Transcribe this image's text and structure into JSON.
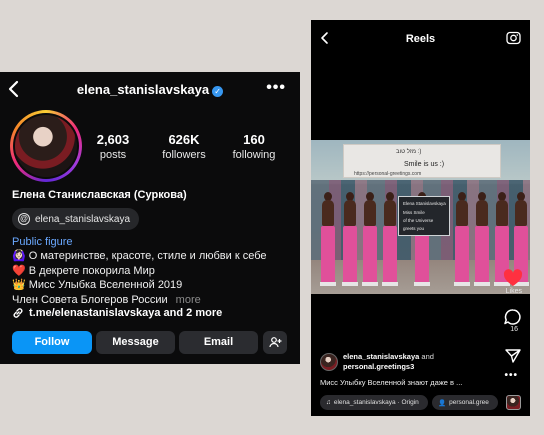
{
  "profile": {
    "username": "elena_stanislavskaya",
    "verified_mark": "✓",
    "more_label": "•••",
    "stats": [
      {
        "value": "2,603",
        "label": "posts"
      },
      {
        "value": "626K",
        "label": "followers"
      },
      {
        "value": "160",
        "label": "following"
      }
    ],
    "full_name": "Елена Станиславская (Суркова)",
    "threads_handle": "elena_stanislavskaya",
    "category": "Public figure",
    "bio_lines": [
      "🙆🏻‍♀️ О материнстве, красоте, стиле и любви к себе",
      "❤️ В декрете покорила Мир",
      "👑 Мисс Улыбка Вселенной 2019",
      "Член Совета Блогеров России"
    ],
    "bio_more": "more",
    "link_text": "t.me/elenastanislavskaya and 2 more",
    "buttons": {
      "follow": "Follow",
      "message": "Message",
      "email": "Email"
    },
    "icons": {
      "back": "chevron-left-icon",
      "more": "more-horizontal-icon",
      "threads": "threads-icon",
      "link": "link-icon",
      "add_user": "add-user-icon"
    },
    "colors": {
      "follow": "#0a95f6",
      "verified": "#3797f0",
      "category": "#6aa8ff"
    }
  },
  "reels": {
    "title": "Reels",
    "likes_label": "Likes",
    "comments_count": "16",
    "more_label": "•••",
    "author": "elena_stanislavskaya",
    "and_word": "and",
    "collaborator": "personal.greetings3",
    "caption": "Мисс Улыбку Вселенной знают даже в ...",
    "audio_chip": "elena_stanislavskaya · Origin",
    "collab_chip": "personal.gree",
    "video": {
      "banner_top": "מזל טוב :)",
      "banner_main": "Smile is us :)",
      "banner_url": "https://personal-greetings.com",
      "sign_lines": [
        "Elena Stanislavskaya",
        "Miss Smile",
        "of the Universe",
        "greets you"
      ]
    },
    "icons": {
      "back": "chevron-left-icon",
      "camera": "camera-icon",
      "heart": "heart-icon",
      "comment": "comment-icon",
      "share": "send-icon",
      "music": "music-icon",
      "person": "person-icon"
    },
    "colors": {
      "heart": "#ff3040"
    }
  }
}
